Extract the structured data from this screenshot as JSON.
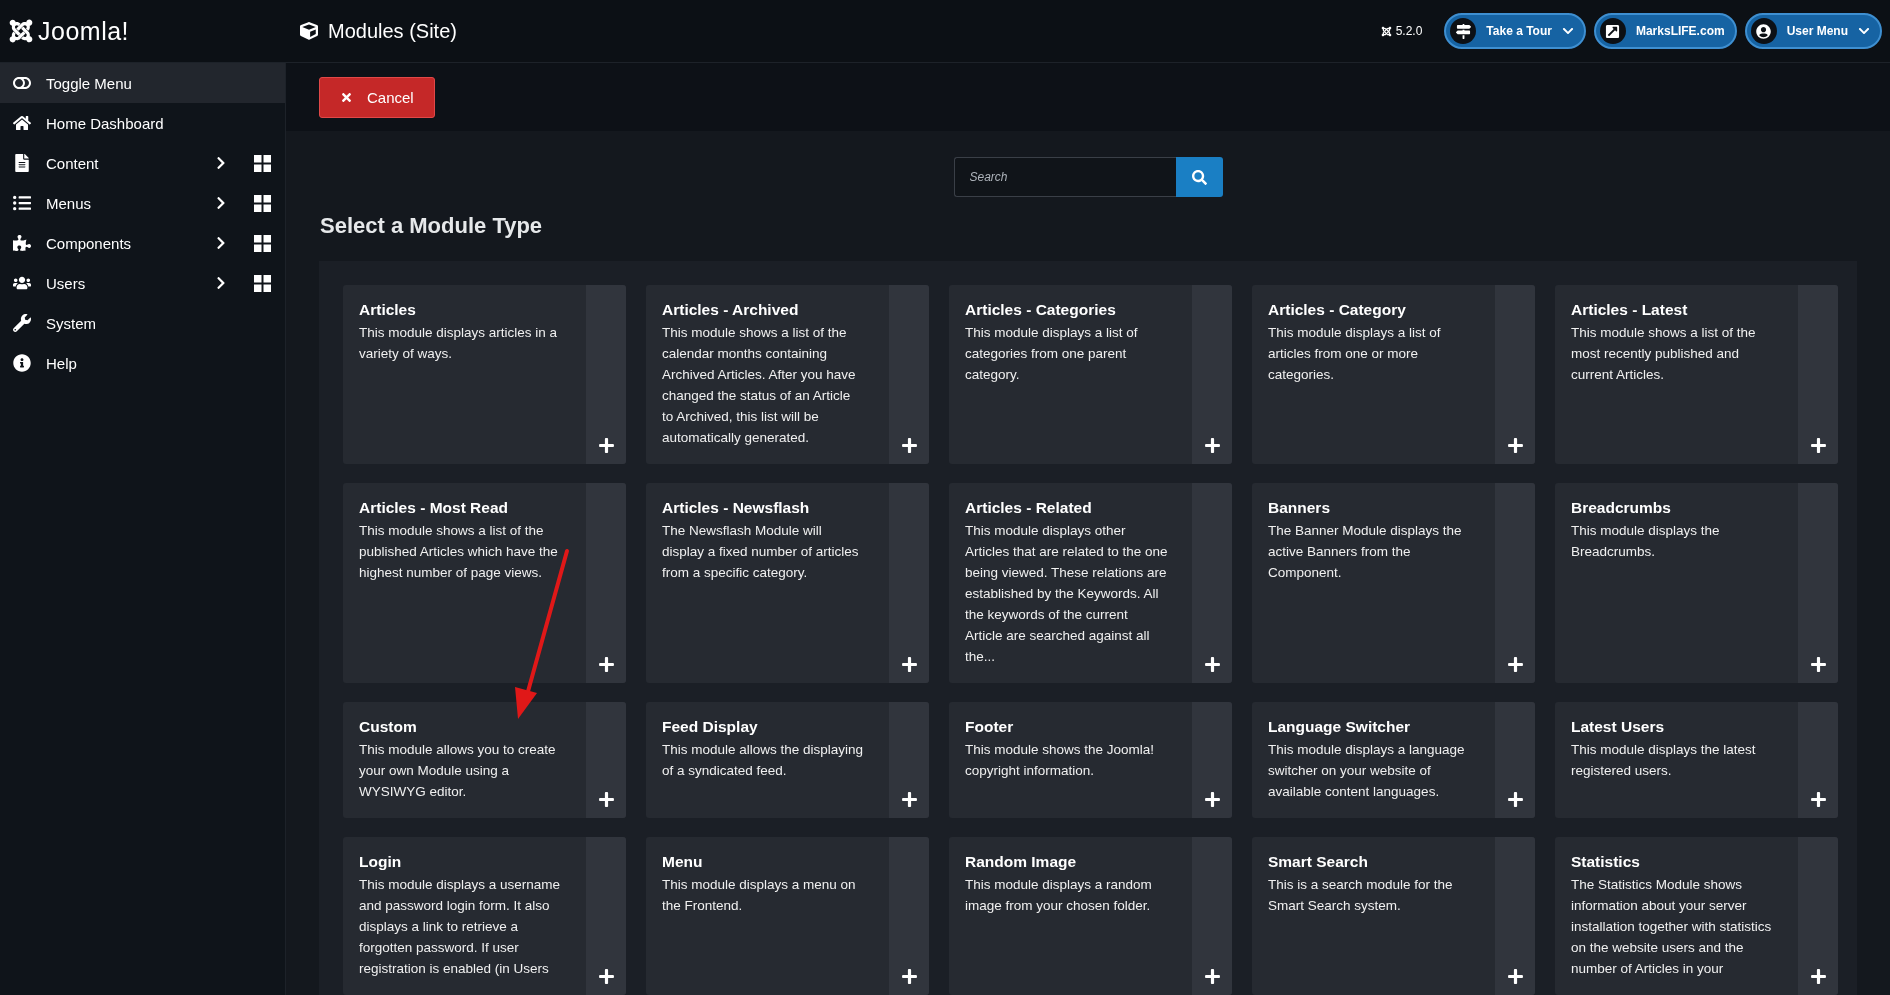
{
  "header": {
    "logo": "Joomla!",
    "title": "Modules (Site)",
    "version": "5.2.0",
    "buttons": [
      {
        "label": "Take a Tour",
        "has_menu": true
      },
      {
        "label": "MarksLIFE.com",
        "has_menu": false
      },
      {
        "label": "User Menu",
        "has_menu": true
      }
    ]
  },
  "sidebar": {
    "items": [
      {
        "label": "Toggle Menu",
        "expandable": false,
        "selected": true
      },
      {
        "label": "Home Dashboard",
        "expandable": false,
        "selected": false
      },
      {
        "label": "Content",
        "expandable": true,
        "selected": false
      },
      {
        "label": "Menus",
        "expandable": true,
        "selected": false
      },
      {
        "label": "Components",
        "expandable": true,
        "selected": false
      },
      {
        "label": "Users",
        "expandable": true,
        "selected": false
      },
      {
        "label": "System",
        "expandable": false,
        "selected": false
      },
      {
        "label": "Help",
        "expandable": false,
        "selected": false
      }
    ]
  },
  "toolbar": {
    "cancel": "Cancel"
  },
  "search": {
    "placeholder": "Search"
  },
  "heading": "Select a Module Type",
  "modules": [
    {
      "title": "Articles",
      "description": "This module displays articles in a variety of ways."
    },
    {
      "title": "Articles - Archived",
      "description": "This module shows a list of the calendar months containing Archived Articles. After you have changed the status of an Article to Archived, this list will be automatically generated."
    },
    {
      "title": "Articles - Categories",
      "description": "This module displays a list of categories from one parent category."
    },
    {
      "title": "Articles - Category",
      "description": "This module displays a list of articles from one or more categories."
    },
    {
      "title": "Articles - Latest",
      "description": "This module shows a list of the most recently published and current Articles."
    },
    {
      "title": "Articles - Most Read",
      "description": "This module shows a list of the published Articles which have the highest number of page views."
    },
    {
      "title": "Articles - Newsflash",
      "description": "The Newsflash Module will display a fixed number of articles from a specific category."
    },
    {
      "title": "Articles - Related",
      "description": "This module displays other Articles that are related to the one being viewed. These relations are established by the Keywords. All the keywords of the current Article are searched against all the..."
    },
    {
      "title": "Banners",
      "description": "The Banner Module displays the active Banners from the Component."
    },
    {
      "title": "Breadcrumbs",
      "description": "This module displays the Breadcrumbs."
    },
    {
      "title": "Custom",
      "description": "This module allows you to create your own Module using a WYSIWYG editor."
    },
    {
      "title": "Feed Display",
      "description": "This module allows the displaying of a syndicated feed."
    },
    {
      "title": "Footer",
      "description": "This module shows the Joomla! copyright information."
    },
    {
      "title": "Language Switcher",
      "description": "This module displays a language switcher on your website of available content languages."
    },
    {
      "title": "Latest Users",
      "description": "This module displays the latest registered users."
    },
    {
      "title": "Login",
      "description": "This module displays a username and password login form. It also displays a link to retrieve a forgotten password. If user registration is enabled (in Users"
    },
    {
      "title": "Menu",
      "description": "This module displays a menu on the Frontend."
    },
    {
      "title": "Random Image",
      "description": "This module displays a random image from your chosen folder."
    },
    {
      "title": "Smart Search",
      "description": "This is a search module for the Smart Search system."
    },
    {
      "title": "Statistics",
      "description": "The Statistics Module shows information about your server installation together with statistics on the website users and the number of Articles in your"
    }
  ]
}
